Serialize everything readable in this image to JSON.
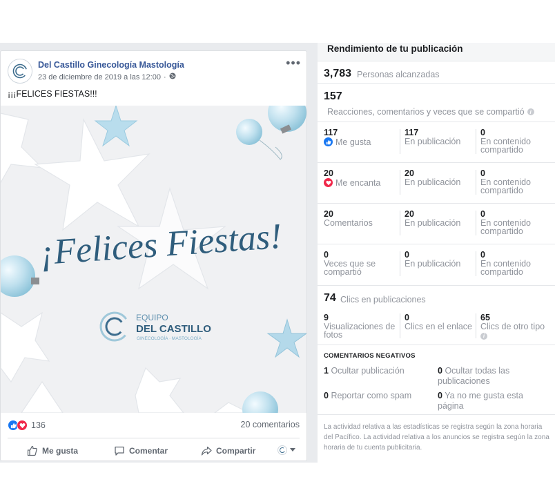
{
  "post": {
    "page_name": "Del Castillo Ginecología Mastología",
    "date": "23 de diciembre de 2019 a las 12:00",
    "date_sep": "·",
    "text": "¡¡¡FELICES FIESTAS!!!",
    "image": {
      "headline": "¡Felices Fiestas!",
      "logo_top": "EQUIPO",
      "logo_main": "DEL CASTILLO",
      "logo_sub": "GINECOLOGÍA · MASTOLOGÍA"
    },
    "reactions_count": "136",
    "comments_count": "20 comentarios",
    "actions": {
      "like": "Me gusta",
      "comment": "Comentar",
      "share": "Compartir"
    }
  },
  "insights": {
    "title": "Rendimiento de tu publicación",
    "reach": {
      "value": "3,783",
      "label": "Personas alcanzadas"
    },
    "engagement": {
      "value": "157",
      "label": "Reacciones, comentarios y veces que se compartió"
    },
    "rows": [
      {
        "total": "117",
        "label": "Me gusta",
        "icon": "like",
        "on_post": "117",
        "on_post_label": "En publicación",
        "on_shares": "0",
        "on_shares_label": "En contenido compartido"
      },
      {
        "total": "20",
        "label": "Me encanta",
        "icon": "love",
        "on_post": "20",
        "on_post_label": "En publicación",
        "on_shares": "0",
        "on_shares_label": "En contenido compartido"
      },
      {
        "total": "20",
        "label": "Comentarios",
        "icon": "",
        "on_post": "20",
        "on_post_label": "En publicación",
        "on_shares": "0",
        "on_shares_label": "En contenido compartido"
      },
      {
        "total": "0",
        "label": "Veces que se compartió",
        "icon": "",
        "on_post": "0",
        "on_post_label": "En publicación",
        "on_shares": "0",
        "on_shares_label": "En contenido compartido"
      }
    ],
    "clicks": {
      "value": "74",
      "label": "Clics en publicaciones",
      "items": [
        {
          "value": "9",
          "label": "Visualizaciones de fotos"
        },
        {
          "value": "0",
          "label": "Clics en el enlace"
        },
        {
          "value": "65",
          "label": "Clics de otro tipo"
        }
      ]
    },
    "negative": {
      "title": "COMENTARIOS NEGATIVOS",
      "items": [
        {
          "value": "1",
          "label": "Ocultar publicación"
        },
        {
          "value": "0",
          "label": "Ocultar todas las publicaciones"
        },
        {
          "value": "0",
          "label": "Reportar como spam"
        },
        {
          "value": "0",
          "label": "Ya no me gusta esta página"
        }
      ]
    },
    "footer": "La actividad relativa a las estadísticas se registra según la zona horaria del Pacífico. La actividad relativa a los anuncios se registra según la zona horaria de tu cuenta publicitaria."
  },
  "colors": {
    "link": "#385898",
    "like": "#1877f2",
    "love": "#f0284a",
    "brand": "#3d6d8e"
  }
}
